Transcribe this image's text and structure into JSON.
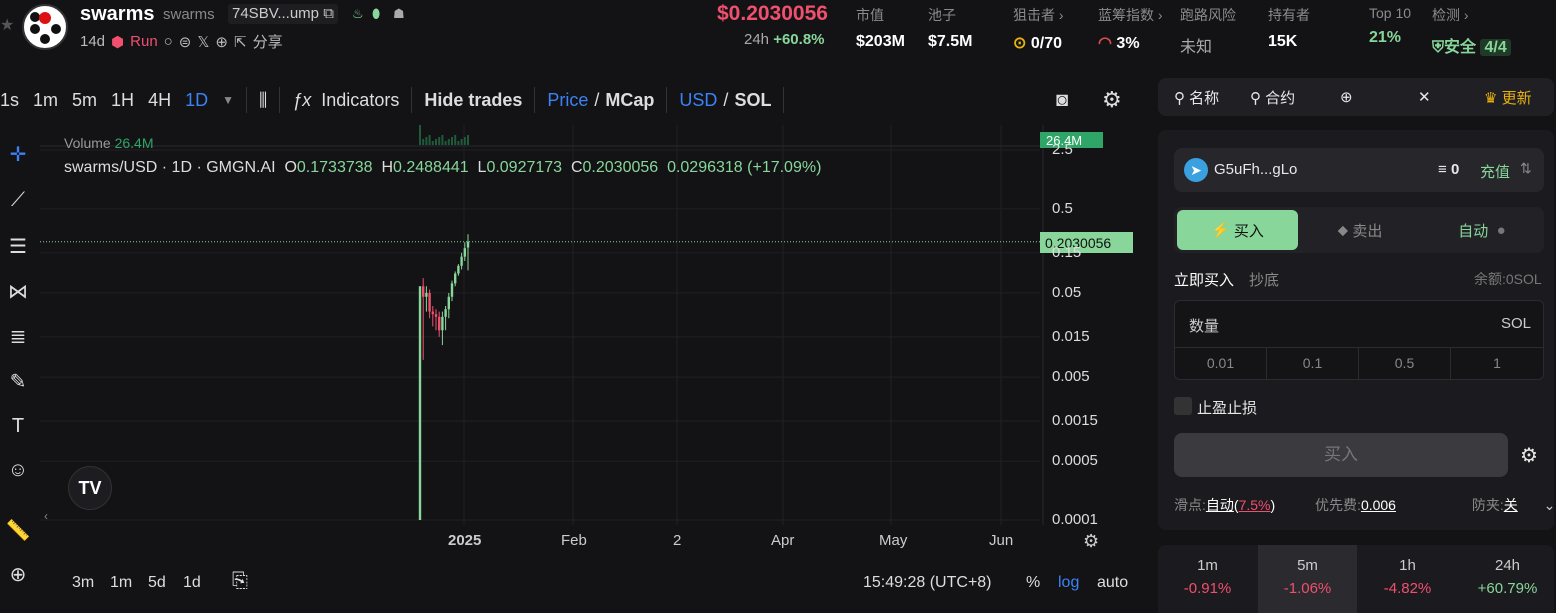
{
  "token": {
    "name": "swarms",
    "symbol": "swarms",
    "address": "74SBV...ump",
    "age": "14d",
    "status": "Run",
    "share": "分享"
  },
  "price": {
    "value": "$0.2030056",
    "change_label": "24h",
    "change_value": "+60.8%"
  },
  "stats": [
    {
      "label": "市值",
      "value": "$203M"
    },
    {
      "label": "池子",
      "value": "$7.5M"
    },
    {
      "label": "狙击者 ›",
      "value": "0/70"
    },
    {
      "label": "蓝筹指数 ›",
      "value": "3%"
    },
    {
      "label": "跑路风险",
      "value": "未知"
    },
    {
      "label": "持有者",
      "value": "15K"
    },
    {
      "label": "Top 10",
      "value": "21%"
    },
    {
      "label": "检测 ›",
      "value": "安全",
      "extra": "4/4"
    }
  ],
  "toolbar": {
    "timeframes": [
      "1s",
      "1m",
      "5m",
      "1H",
      "4H",
      "1D"
    ],
    "active_timeframe": "1D",
    "indicators": "Indicators",
    "hide_trades": "Hide trades",
    "price": "Price",
    "mcap": "MCap",
    "usd": "USD",
    "sol": "SOL",
    "slash": "/"
  },
  "chart": {
    "volume_label": "Volume",
    "volume_value": "26.4M",
    "volume_tag": "26.4M",
    "title": "swarms/USD · 1D · GMGN.AI",
    "ohlc": {
      "o_label": "O",
      "o": "0.1733738",
      "h_label": "H",
      "h": "0.2488441",
      "l_label": "L",
      "l": "0.0927173",
      "c_label": "C",
      "c": "0.2030056",
      "chg": "0.0296318 (+17.09%)"
    },
    "price_tag": "0.2030056",
    "y_ticks": [
      "2.5",
      "0.5",
      "0.15",
      "0.05",
      "0.015",
      "0.005",
      "0.0015",
      "0.0005",
      "0.0001"
    ],
    "x_ticks": [
      "2025",
      "Feb",
      "2",
      "Apr",
      "May",
      "Jun"
    ]
  },
  "chart_data": {
    "type": "candlestick",
    "title": "swarms/USD · 1D · GMGN.AI",
    "y_scale": "log",
    "ylim": [
      0.0001,
      2.5
    ],
    "candles": [
      {
        "o": 0.0001,
        "h": 0.06,
        "l": 0.0001,
        "c": 0.06,
        "up": true
      },
      {
        "o": 0.06,
        "h": 0.075,
        "l": 0.008,
        "c": 0.045,
        "up": false
      },
      {
        "o": 0.045,
        "h": 0.06,
        "l": 0.03,
        "c": 0.05,
        "up": true
      },
      {
        "o": 0.05,
        "h": 0.055,
        "l": 0.025,
        "c": 0.03,
        "up": false
      },
      {
        "o": 0.03,
        "h": 0.035,
        "l": 0.02,
        "c": 0.028,
        "up": false
      },
      {
        "o": 0.028,
        "h": 0.032,
        "l": 0.018,
        "c": 0.026,
        "up": false
      },
      {
        "o": 0.026,
        "h": 0.03,
        "l": 0.015,
        "c": 0.018,
        "up": false
      },
      {
        "o": 0.018,
        "h": 0.03,
        "l": 0.012,
        "c": 0.026,
        "up": true
      },
      {
        "o": 0.026,
        "h": 0.035,
        "l": 0.018,
        "c": 0.032,
        "up": true
      },
      {
        "o": 0.032,
        "h": 0.05,
        "l": 0.025,
        "c": 0.045,
        "up": true
      },
      {
        "o": 0.045,
        "h": 0.07,
        "l": 0.04,
        "c": 0.065,
        "up": true
      },
      {
        "o": 0.065,
        "h": 0.09,
        "l": 0.06,
        "c": 0.085,
        "up": true
      },
      {
        "o": 0.085,
        "h": 0.11,
        "l": 0.08,
        "c": 0.105,
        "up": true
      },
      {
        "o": 0.105,
        "h": 0.15,
        "l": 0.095,
        "c": 0.135,
        "up": true
      },
      {
        "o": 0.135,
        "h": 0.2,
        "l": 0.12,
        "c": 0.17,
        "up": true
      },
      {
        "o": 0.1733738,
        "h": 0.2488441,
        "l": 0.0927173,
        "c": 0.2030056,
        "up": true
      }
    ]
  },
  "bottom": {
    "ranges": [
      "3m",
      "1m",
      "5d",
      "1d"
    ],
    "time": "15:49:28 (UTC+8)",
    "pct": "%",
    "log": "log",
    "auto": "auto"
  },
  "panel": {
    "search_name": "名称",
    "search_contract": "合约",
    "update": "更新",
    "wallet": "G5uFh...gLo",
    "balance": "0",
    "deposit": "充值",
    "buy": "买入",
    "sell": "卖出",
    "auto": "自动",
    "buy_now": "立即买入",
    "dip": "抄底",
    "balance_text": "余额:0SOL",
    "qty_label": "数量",
    "qty_unit": "SOL",
    "presets": [
      "0.01",
      "0.1",
      "0.5",
      "1"
    ],
    "tpsl": "止盈止损",
    "buy_btn": "买入",
    "slippage_label": "滑点:",
    "slippage_mode": "自动",
    "slippage_value": "7.5%",
    "priority_label": "优先费:",
    "priority_value": "0.006",
    "mev_label": "防夹:",
    "mev_value": "关"
  },
  "intervals": [
    {
      "label": "1m",
      "value": "-0.91%",
      "up": false
    },
    {
      "label": "5m",
      "value": "-1.06%",
      "up": false
    },
    {
      "label": "1h",
      "value": "-4.82%",
      "up": false
    },
    {
      "label": "24h",
      "value": "+60.79%",
      "up": true
    }
  ]
}
